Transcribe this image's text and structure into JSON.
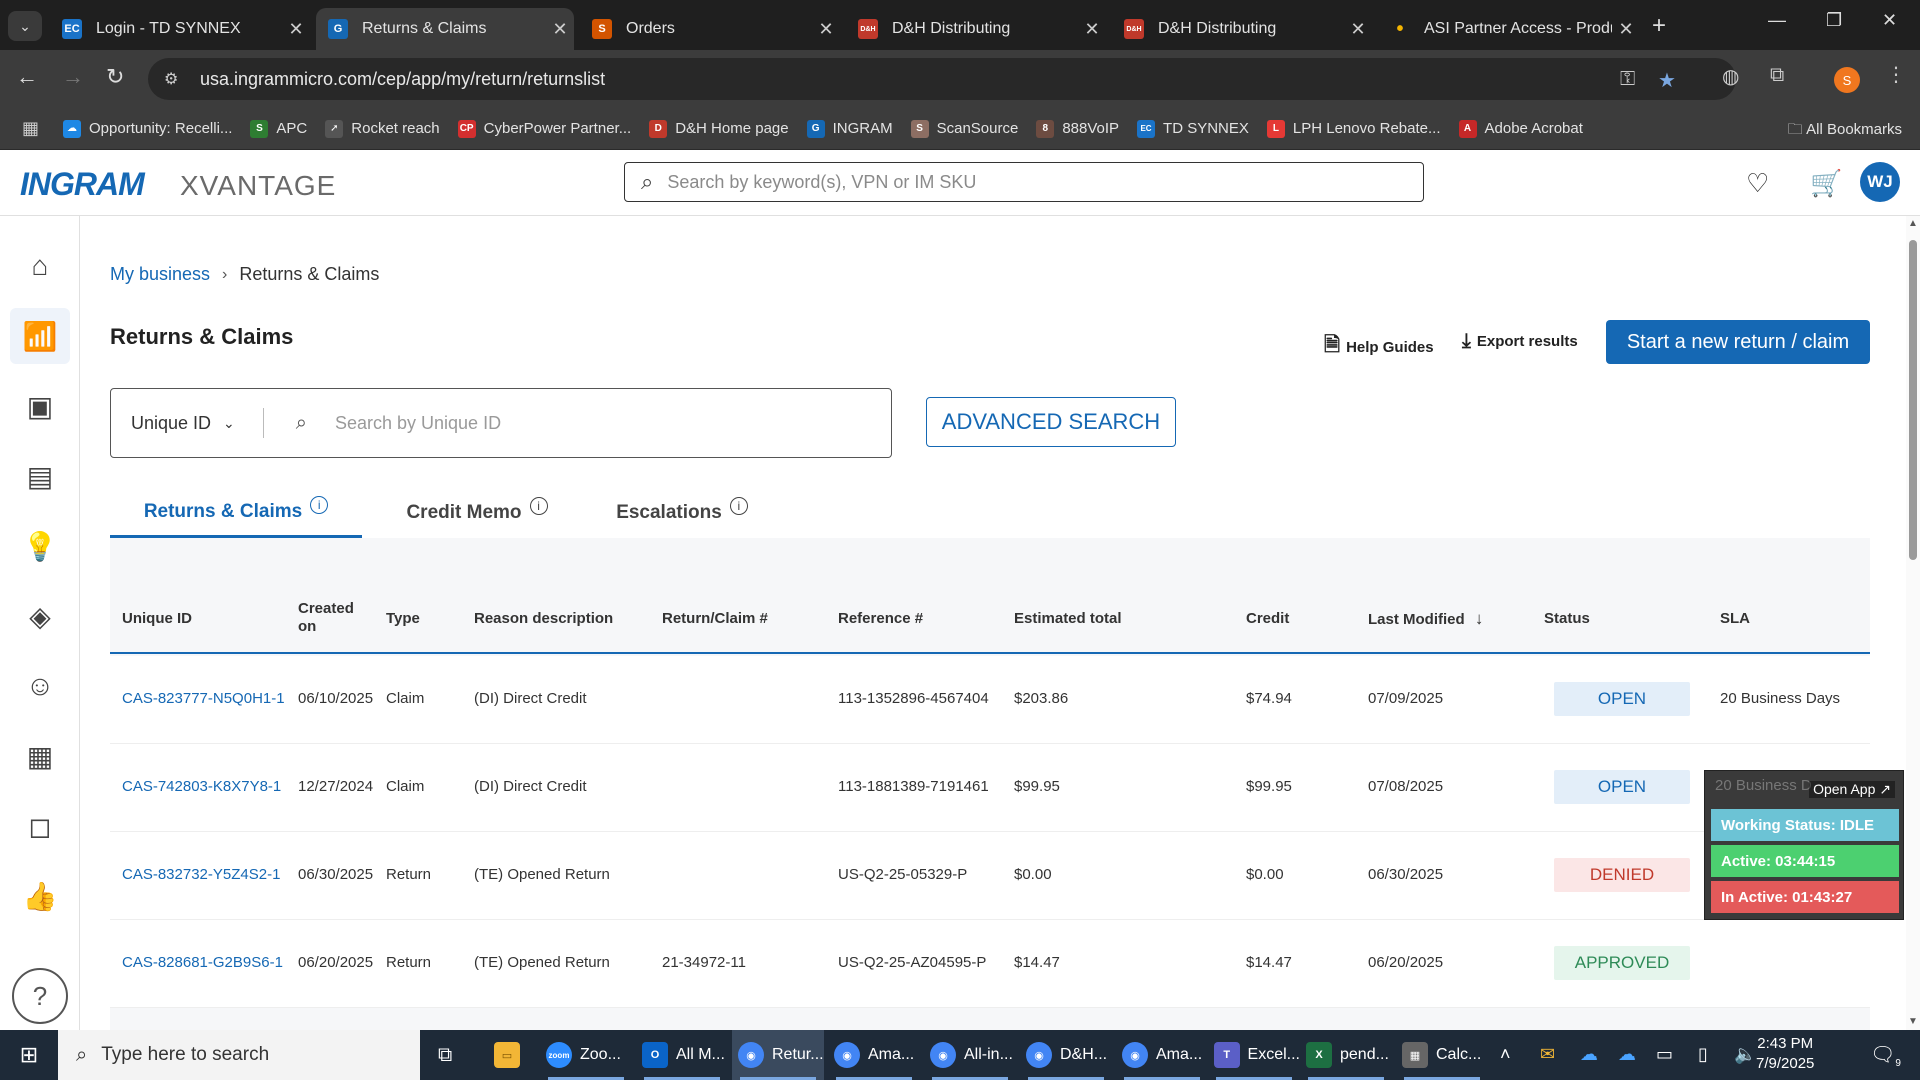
{
  "browser": {
    "tabs": [
      {
        "label": "Login - TD SYNNEX",
        "icon": "EC",
        "color": "#1a73c8"
      },
      {
        "label": "Returns & Claims",
        "icon": "G",
        "color": "#1568b4"
      },
      {
        "label": "Orders",
        "icon": "S",
        "color": "#d35400"
      },
      {
        "label": "D&H Distributing",
        "icon": "D&H",
        "color": "#c0392b"
      },
      {
        "label": "D&H Distributing",
        "icon": "D&H",
        "color": "#c0392b"
      },
      {
        "label": "ASI Partner Access - Produ",
        "icon": "•",
        "color": "#2a5db0"
      }
    ],
    "url": "usa.ingrammicro.com/cep/app/my/return/returnslist",
    "profile_initial": "S",
    "bookmarks": [
      {
        "label": "Opportunity: Recelli...",
        "icon": "☁",
        "color": "#1e88e5"
      },
      {
        "label": "APC",
        "icon": "S",
        "color": "#2e7d32"
      },
      {
        "label": "Rocket reach",
        "icon": "➚",
        "color": "#555"
      },
      {
        "label": "CyberPower Partner...",
        "icon": "CP",
        "color": "#d32f2f"
      },
      {
        "label": "D&H Home page",
        "icon": "D",
        "color": "#c0392b"
      },
      {
        "label": "INGRAM",
        "icon": "G",
        "color": "#1568b4"
      },
      {
        "label": "ScanSource",
        "icon": "S",
        "color": "#8d6e63"
      },
      {
        "label": "888VoIP",
        "icon": "8",
        "color": "#6d4c41"
      },
      {
        "label": "TD SYNNEX",
        "icon": "EC",
        "color": "#1a73c8"
      },
      {
        "label": "LPH Lenovo Rebate...",
        "icon": "L",
        "color": "#e53935"
      },
      {
        "label": "Adobe Acrobat",
        "icon": "A",
        "color": "#c62828"
      }
    ],
    "all_bookmarks": "All Bookmarks"
  },
  "header": {
    "logo_main": "INGRAM",
    "logo_sub": "XVANTAGE",
    "search_placeholder": "Search by keyword(s), VPN or IM SKU",
    "avatar_initials": "WJ"
  },
  "breadcrumb": {
    "parent": "My business",
    "current": "Returns & Claims"
  },
  "page": {
    "title": "Returns & Claims",
    "help_guides": "Help Guides",
    "export_results": "Export results",
    "start_button": "Start a new return / claim",
    "search_type": "Unique ID",
    "search_placeholder": "Search by Unique ID",
    "advanced_search": "ADVANCED SEARCH",
    "tabs": [
      {
        "label": "Returns & Claims"
      },
      {
        "label": "Credit Memo"
      },
      {
        "label": "Escalations"
      }
    ]
  },
  "table": {
    "columns": [
      "Unique ID",
      "Created on",
      "Type",
      "Reason description",
      "Return/Claim #",
      "Reference #",
      "Estimated total",
      "Credit",
      "Last Modified",
      "Status",
      "SLA"
    ],
    "rows": [
      {
        "id": "CAS-823777-N5Q0H1-1",
        "created": "06/10/2025",
        "type": "Claim",
        "reason": "(DI) Direct Credit",
        "claim": "",
        "ref": "113-1352896-4567404",
        "est": "$203.86",
        "credit": "$74.94",
        "modified": "07/09/2025",
        "status": "OPEN",
        "sla": "20 Business Days"
      },
      {
        "id": "CAS-742803-K8X7Y8-1",
        "created": "12/27/2024",
        "type": "Claim",
        "reason": "(DI) Direct Credit",
        "claim": "",
        "ref": "113-1881389-7191461",
        "est": "$99.95",
        "credit": "$99.95",
        "modified": "07/08/2025",
        "status": "OPEN",
        "sla": ""
      },
      {
        "id": "CAS-832732-Y5Z4S2-1",
        "created": "06/30/2025",
        "type": "Return",
        "reason": "(TE) Opened Return",
        "claim": "",
        "ref": "US-Q2-25-05329-P",
        "est": "$0.00",
        "credit": "$0.00",
        "modified": "06/30/2025",
        "status": "DENIED",
        "sla": ""
      },
      {
        "id": "CAS-828681-G2B9S6-1",
        "created": "06/20/2025",
        "type": "Return",
        "reason": "(TE) Opened Return",
        "claim": "21-34972-11",
        "ref": "US-Q2-25-AZ04595-P",
        "est": "$14.47",
        "credit": "$14.47",
        "modified": "06/20/2025",
        "status": "APPROVED",
        "sla": ""
      }
    ]
  },
  "widget": {
    "open_app": "Open App ↗",
    "ghost": "20 Business D",
    "working_status": "Working Status: IDLE",
    "active": "Active: 03:44:15",
    "inactive": "In Active: 01:43:27"
  },
  "taskbar": {
    "search_text": "Type here to search",
    "apps": [
      {
        "label": "Zoo...",
        "icon": "zoom",
        "color": "#2d8cff"
      },
      {
        "label": "All M...",
        "icon": "O",
        "color": "#0a64c8"
      },
      {
        "label": "Retur...",
        "icon": "◉",
        "color": "#4285f4"
      },
      {
        "label": "Ama...",
        "icon": "◉",
        "color": "#4285f4"
      },
      {
        "label": "All-in...",
        "icon": "◉",
        "color": "#4285f4"
      },
      {
        "label": "D&H...",
        "icon": "◉",
        "color": "#4285f4"
      },
      {
        "label": "Ama...",
        "icon": "◉",
        "color": "#4285f4"
      },
      {
        "label": "Excel...",
        "icon": "T",
        "color": "#5b5fc7"
      },
      {
        "label": "pend...",
        "icon": "X",
        "color": "#1d6f42"
      },
      {
        "label": "Calc...",
        "icon": "▦",
        "color": "#666"
      }
    ],
    "time": "2:43 PM",
    "date": "7/9/2025",
    "notif_count": "9"
  }
}
